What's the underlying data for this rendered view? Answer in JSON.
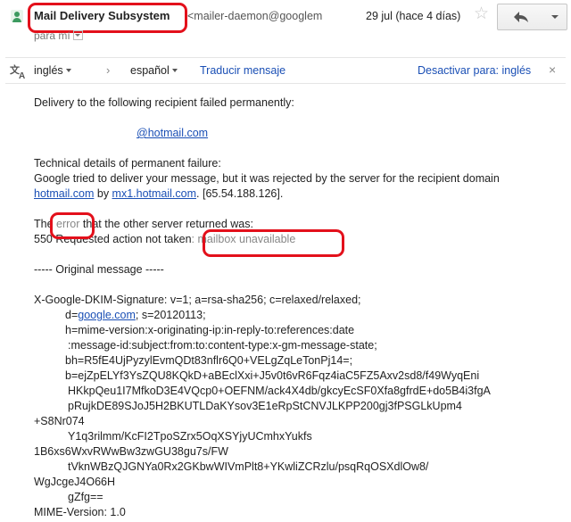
{
  "header": {
    "sender_name": "Mail Delivery Subsystem",
    "sender_email": "<mailer-daemon@googlem",
    "date": "29 jul (hace 4 días)",
    "to_line": "para mí"
  },
  "translate": {
    "from_lang": "inglés",
    "to_lang": "español",
    "translate_link": "Traducir mensaje",
    "disable_link": "Desactivar para: inglés",
    "arrow": "›",
    "close": "×"
  },
  "body": {
    "intro": "Delivery to the following recipient failed permanently:",
    "recipient": "@hotmail.com",
    "tech_heading": "Technical details of permanent failure:",
    "tech_line1": "Google tried to deliver your message, but it was rejected by the server for the recipient domain",
    "tech_domain": "hotmail.com",
    "tech_by": " by ",
    "tech_server": "mx1.hotmail.com",
    "tech_ip": ". [65.54.188.126].",
    "error_pre": "The ",
    "error_word": "error",
    "error_post": " that the other server returned was:",
    "code_line_pre": "550 Requested action not taken",
    "code_line_post": ": mailbox unavailable",
    "original_sep": "----- Original message -----",
    "dkim": "X-Google-DKIM-Signature: v=1; a=rsa-sha256; c=relaxed/relaxed;",
    "d_pre": "d=",
    "d_link": "google.com",
    "d_post": "; s=20120113;",
    "h1": "h=mime-version:x-originating-ip:in-reply-to:references:date",
    "h2": ":message-id:subject:from:to:content-type:x-gm-message-state;",
    "bh": "bh=R5fE4UjPyzylEvmQDt83nflr6Q0+VELgZqLeTonPj14=;",
    "b1": "b=ejZpELYf3YsZQU8KQkD+aBEclXxi+J5v0t6vR6Fqz4iaC5FZ5Axv2sd8/f49WyqEni",
    "b2": "HKkpQeu1I7MfkoD3E4VQcp0+OEFNM/ack4X4db/gkcyEcSF0Xfa8gfrdE+do5B4i3fgA",
    "b3": "pRujkDE89SJoJ5H2BKUTLDaKYsov3E1eRpStCNVJLKPP200gj3fPSGLkUpm4",
    "b4": "+S8Nr074",
    "b5": "Y1q3rilmm/KcFI2TpoSZrx5OqXSYjyUCmhxYukfs",
    "b6": "1B6xs6WxvRWwBw3zwGU38gu7s/FW",
    "b7": "tVknWBzQJGNYa0Rx2GKbwWIVmPlt8+YKwliZCRzlu/psqRqOSXdlOw8/",
    "b8": "WgJcgeJ4O66H",
    "b9": "gZfg==",
    "mime": "MIME-Version: 1.0"
  },
  "icons": {
    "person": "person-icon",
    "star": "star-icon",
    "reply": "reply-icon",
    "translate": "translate-icon"
  },
  "colors": {
    "link": "#1a4fb5",
    "highlight": "#e3101b",
    "person": "#3c9a5f"
  }
}
